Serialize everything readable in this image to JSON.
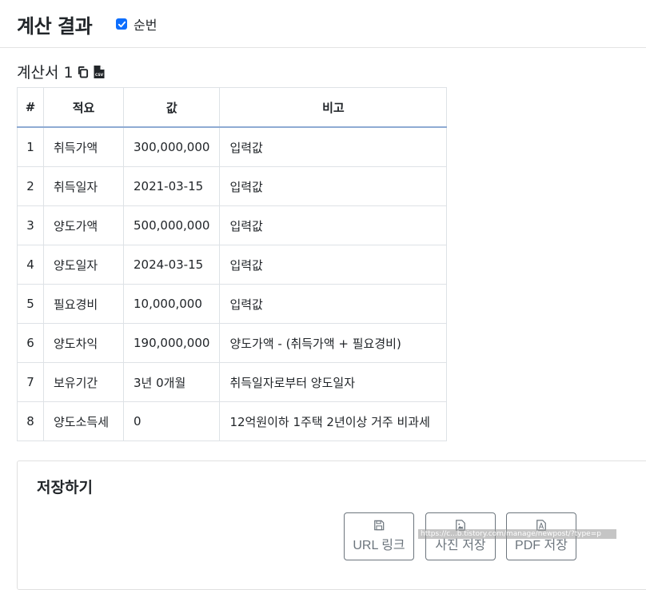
{
  "header": {
    "title": "계산 결과",
    "checkbox_label": "순번",
    "checkbox_checked": true
  },
  "sheet": {
    "title": "계산서 1",
    "copy_icon": "copy-icon",
    "csv_icon": "csv-file-icon"
  },
  "table": {
    "columns": [
      "#",
      "적요",
      "값",
      "비고"
    ],
    "rows": [
      [
        "1",
        "취득가액",
        "300,000,000",
        "입력값"
      ],
      [
        "2",
        "취득일자",
        "2021-03-15",
        "입력값"
      ],
      [
        "3",
        "양도가액",
        "500,000,000",
        "입력값"
      ],
      [
        "4",
        "양도일자",
        "2024-03-15",
        "입력값"
      ],
      [
        "5",
        "필요경비",
        "10,000,000",
        "입력값"
      ],
      [
        "6",
        "양도차익",
        "190,000,000",
        "양도가액 - (취득가액 + 필요경비)"
      ],
      [
        "7",
        "보유기간",
        "3년 0개월",
        "취득일자로부터 양도일자"
      ],
      [
        "8",
        "양도소득세",
        "0",
        "12억원이하 1주택 2년이상 거주 비과세"
      ]
    ]
  },
  "save": {
    "title": "저장하기",
    "buttons": [
      {
        "label": "URL 링크",
        "icon": "floppy-disk-icon"
      },
      {
        "label": "사진 저장",
        "icon": "image-file-icon"
      },
      {
        "label": "PDF 저장",
        "icon": "pdf-file-icon"
      }
    ]
  },
  "watermark": "https://c...b.tistory.com/manage/newpost/?type=p",
  "colors": {
    "accent": "#0d6efd",
    "header_border": "#8fabd3",
    "border": "#dee2e6"
  }
}
